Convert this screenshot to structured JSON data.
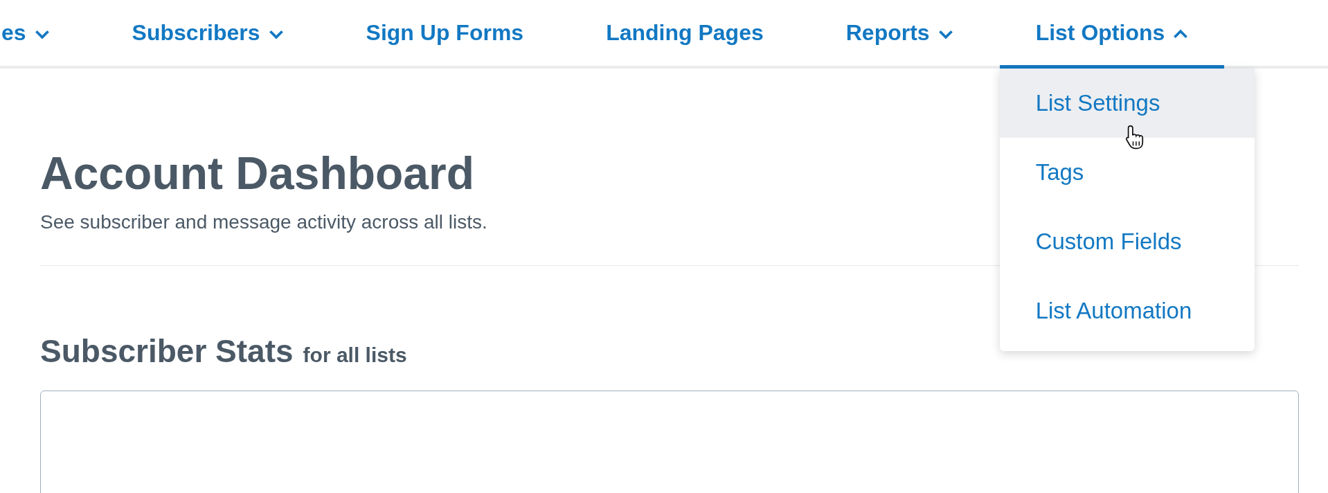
{
  "nav": [
    {
      "label": "es",
      "kind": "dropdown",
      "expanded": false,
      "selected": false
    },
    {
      "label": "Subscribers",
      "kind": "dropdown",
      "expanded": false,
      "selected": false
    },
    {
      "label": "Sign Up Forms",
      "kind": "link",
      "selected": false
    },
    {
      "label": "Landing Pages",
      "kind": "link",
      "selected": false
    },
    {
      "label": "Reports",
      "kind": "dropdown",
      "expanded": false,
      "selected": false
    },
    {
      "label": "List Options",
      "kind": "dropdown",
      "expanded": true,
      "selected": true
    }
  ],
  "dropdown": [
    {
      "label": "List Settings",
      "hovered": true
    },
    {
      "label": "Tags",
      "hovered": false
    },
    {
      "label": "Custom Fields",
      "hovered": false
    },
    {
      "label": "List Automation",
      "hovered": false
    }
  ],
  "page": {
    "title": "Account Dashboard",
    "subtitle": "See subscriber and message activity across all lists."
  },
  "stats": {
    "title": "Subscriber Stats",
    "qualifier": "for all lists"
  }
}
